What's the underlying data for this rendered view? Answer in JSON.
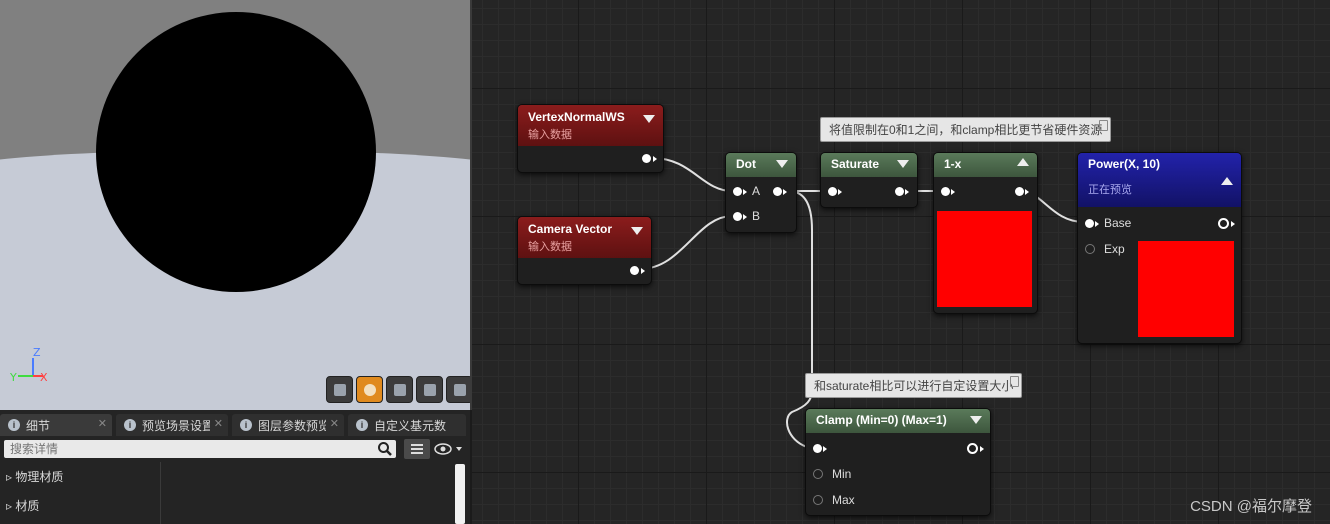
{
  "viewport": {
    "axis_z": "Z",
    "axis_y": "Y",
    "axis_x": "X",
    "toolbar_buttons": [
      "cylinder",
      "sphere",
      "plane",
      "cube",
      "teapot"
    ]
  },
  "details": {
    "tabs": [
      {
        "label": "细节",
        "active": true
      },
      {
        "label": "预览场景设置"
      },
      {
        "label": "图层参数预览"
      },
      {
        "label": "自定义基元数"
      }
    ],
    "search_placeholder": "搜索详情",
    "categories": [
      "物理材质",
      "材质"
    ]
  },
  "graph": {
    "nodes": {
      "vertex_normal": {
        "title": "VertexNormalWS",
        "subtitle": "输入数据"
      },
      "camera_vector": {
        "title": "Camera Vector",
        "subtitle": "输入数据"
      },
      "dot": {
        "title": "Dot",
        "pin_a": "A",
        "pin_b": "B"
      },
      "saturate": {
        "title": "Saturate"
      },
      "one_minus": {
        "title": "1-x"
      },
      "power": {
        "title": "Power(X, 10)",
        "subtitle": "正在预览",
        "pin_base": "Base",
        "pin_exp": "Exp"
      },
      "clamp": {
        "title": "Clamp (Min=0) (Max=1)",
        "pin_min": "Min",
        "pin_max": "Max"
      }
    },
    "comments": {
      "saturate_note": "将值限制在0和1之间，和clamp相比更节省硬件资源",
      "clamp_note": "和saturate相比可以进行自定设置大小"
    },
    "preview_color": "#ff0000"
  },
  "watermark": "CSDN @福尔摩登"
}
